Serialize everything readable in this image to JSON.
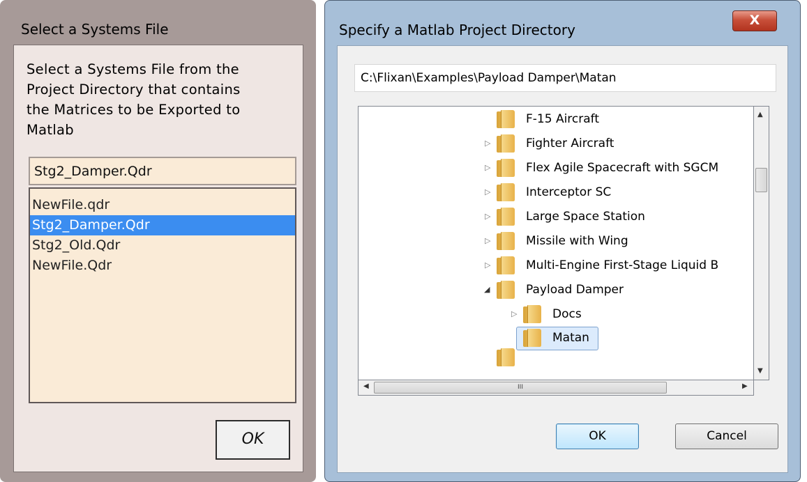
{
  "left_dialog": {
    "title": "Select a Systems File",
    "prompt_lines": [
      "Select a Systems File from the",
      "Project Directory that contains",
      "the Matrices to be Exported to",
      "Matlab"
    ],
    "selected_value": "Stg2_Damper.Qdr",
    "files": [
      "NewFile.qdr",
      "Stg2_Damper.Qdr",
      "Stg2_Old.Qdr",
      "NewFile.Qdr"
    ],
    "ok_label": "OK"
  },
  "right_dialog": {
    "title": "Specify a Matlab Project Directory",
    "close_label": "X",
    "path_value": "C:\\Flixan\\Examples\\Payload Damper\\Matan",
    "tree": [
      {
        "label": "F-15 Aircraft",
        "expander": ""
      },
      {
        "label": "Fighter Aircraft",
        "expander": "▷"
      },
      {
        "label": "Flex Agile Spacecraft with SGCM",
        "expander": "▷"
      },
      {
        "label": "Interceptor SC",
        "expander": "▷"
      },
      {
        "label": "Large Space Station",
        "expander": "▷"
      },
      {
        "label": "Missile with Wing",
        "expander": "▷"
      },
      {
        "label": "Multi-Engine First-Stage Liquid B",
        "expander": "▷"
      },
      {
        "label": "Payload Damper",
        "expander": "◢"
      },
      {
        "label": "Docs",
        "expander": "▷"
      },
      {
        "label": "Matan",
        "expander": ""
      }
    ],
    "ok_label": "OK",
    "cancel_label": "Cancel",
    "hscroll_grip": "III"
  }
}
